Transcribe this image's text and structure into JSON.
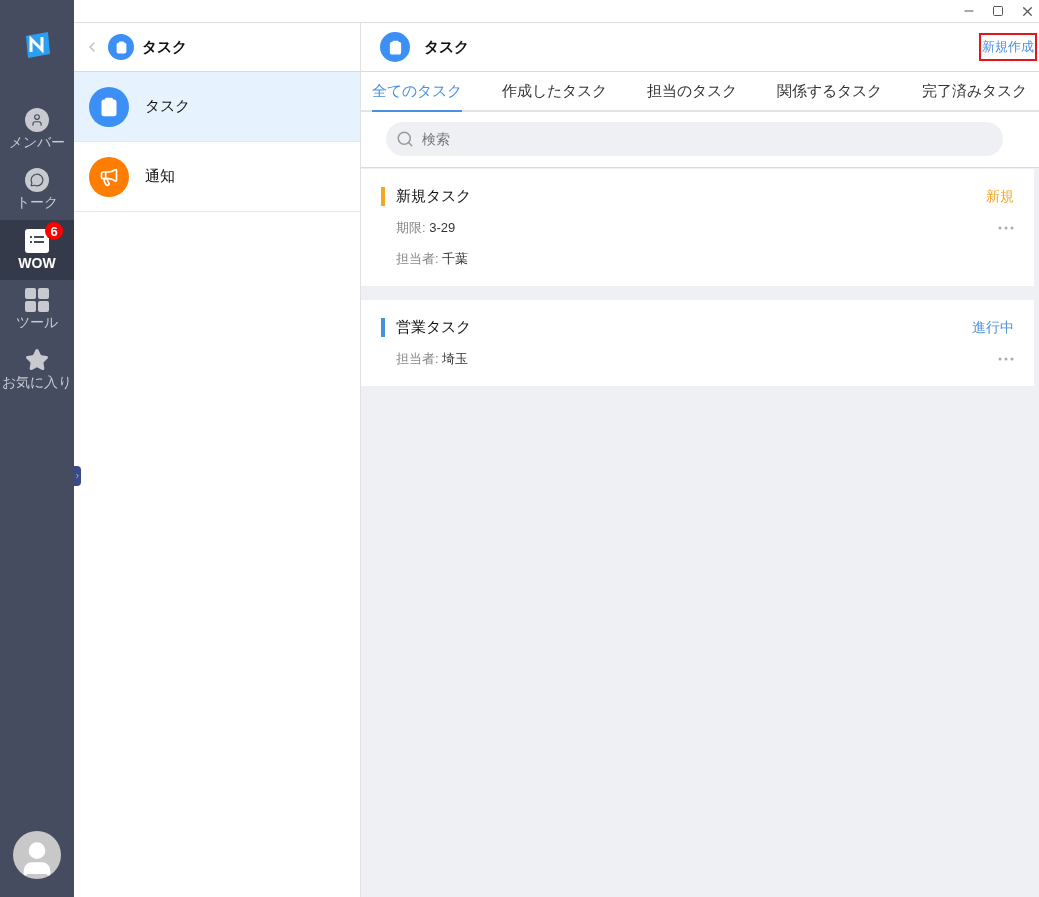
{
  "nav": {
    "items": [
      {
        "kind": "member",
        "label": "メンバー",
        "selected": false
      },
      {
        "kind": "talk",
        "label": "トーク",
        "selected": false
      },
      {
        "kind": "wow",
        "label": "WOW",
        "selected": true,
        "badge": "6"
      },
      {
        "kind": "tools",
        "label": "ツール",
        "selected": false
      },
      {
        "kind": "favorite",
        "label": "お気に入り",
        "selected": false
      }
    ]
  },
  "list_panel": {
    "title": "タスク",
    "items": [
      {
        "kind": "task",
        "label": "タスク",
        "selected": true
      },
      {
        "kind": "notice",
        "label": "通知",
        "selected": false
      }
    ]
  },
  "main": {
    "title": "タスク",
    "new_button": {
      "label": "新規作成",
      "outlined": true
    },
    "tabs": [
      {
        "label": "全てのタスク",
        "selected": true
      },
      {
        "label": "作成したタスク",
        "selected": false
      },
      {
        "label": "担当のタスク",
        "selected": false
      },
      {
        "label": "関係するタスク",
        "selected": false
      },
      {
        "label": "完了済みタスク",
        "selected": false
      }
    ],
    "search": {
      "placeholder": "検索"
    },
    "tasks": [
      {
        "title": "新規タスク",
        "color": "#f5a623",
        "status": {
          "label": "新規",
          "color": "#f5a623"
        },
        "fields": [
          {
            "label": "期限:",
            "value": "3-29"
          },
          {
            "label": "担当者:",
            "value": "千葉"
          }
        ]
      },
      {
        "title": "営業タスク",
        "color": "#4a90d9",
        "status": {
          "label": "進行中",
          "color": "#4a90d9"
        },
        "fields": [
          {
            "label": "担当者:",
            "value": "埼玉"
          }
        ]
      }
    ]
  }
}
